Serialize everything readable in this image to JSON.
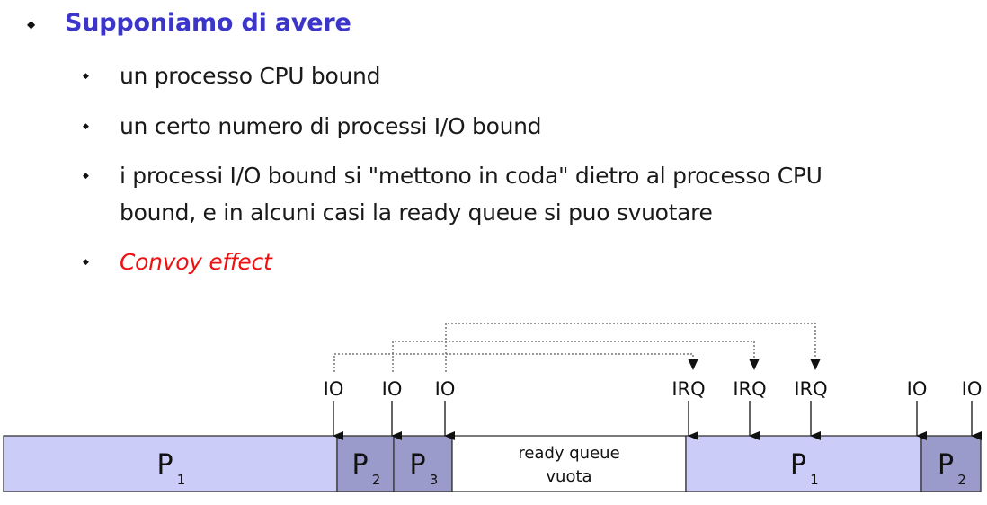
{
  "bullets": {
    "heading": "Supponiamo di avere",
    "items": [
      "un processo CPU bound",
      "un certo numero di processi I/O bound",
      "i processi I/O bound si \"mettono in coda\" dietro al processo CPU",
      "bound, e in alcuni casi la ready queue si puo svuotare",
      "Convoy effect"
    ]
  },
  "diagram": {
    "blocks": [
      {
        "name": "P",
        "sub": "1",
        "kind": "cpu",
        "start": 0,
        "end": 371
      },
      {
        "name": "P",
        "sub": "2",
        "kind": "io",
        "start": 371,
        "end": 434
      },
      {
        "name": "P",
        "sub": "3",
        "kind": "io",
        "start": 434,
        "end": 499
      },
      {
        "name": "ready queue",
        "name2": "vuota",
        "kind": "empty",
        "start": 499,
        "end": 759
      },
      {
        "name": "P",
        "sub": "1",
        "kind": "cpu",
        "start": 759,
        "end": 1021
      },
      {
        "name": "P",
        "sub": "2",
        "kind": "io",
        "start": 1021,
        "end": 1087
      }
    ],
    "events": [
      {
        "label": "IO",
        "t": 367
      },
      {
        "label": "IO",
        "t": 432
      },
      {
        "label": "IO",
        "t": 491
      },
      {
        "label": "IRQ",
        "t": 762
      },
      {
        "label": "IRQ",
        "t": 830
      },
      {
        "label": "IRQ",
        "t": 898
      },
      {
        "label": "IO",
        "t": 1016
      },
      {
        "label": "IO",
        "t": 1077
      }
    ],
    "links": [
      {
        "from": 0,
        "to": 3
      },
      {
        "from": 1,
        "to": 4
      },
      {
        "from": 2,
        "to": 5
      }
    ],
    "colors": {
      "cpu": "#ccccf9",
      "io": "#9a9acb",
      "empty": "#ffffff",
      "border": "#333333",
      "dotted": "#777777"
    }
  }
}
